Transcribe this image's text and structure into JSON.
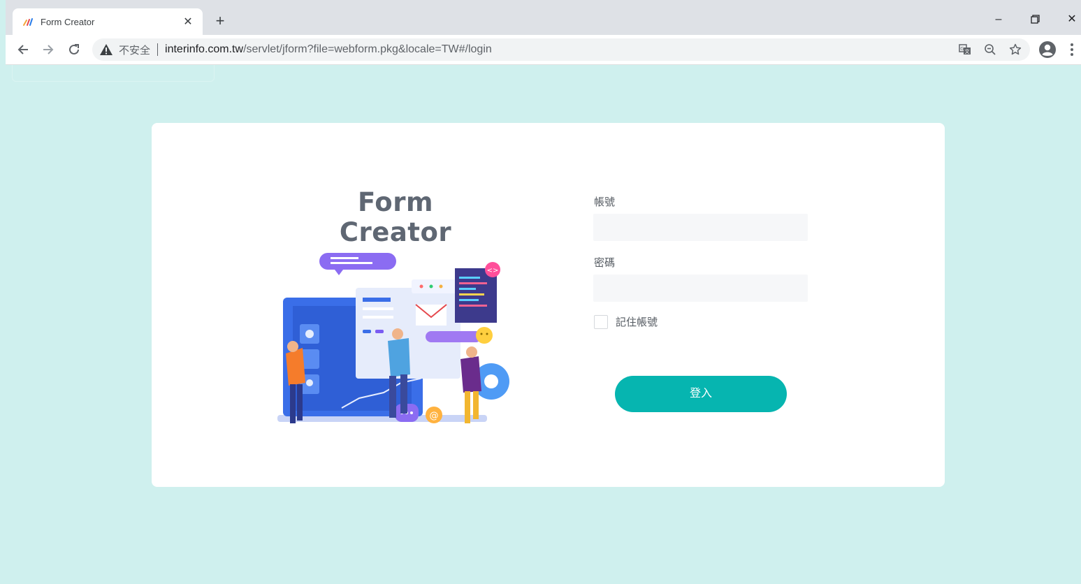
{
  "browser": {
    "tab": {
      "title": "Form Creator"
    },
    "address": {
      "security_label": "不安全",
      "host": "interinfo.com.tw",
      "path": "/servlet/jform?file=webform.pkg&locale=TW#/login"
    }
  },
  "login": {
    "brand": "Form Creator",
    "account_label": "帳號",
    "account_value": "",
    "password_label": "密碼",
    "password_value": "",
    "remember_label": "記住帳號",
    "remember_checked": false,
    "submit_label": "登入"
  },
  "colors": {
    "page_background": "#cff0ee",
    "card": "#ffffff",
    "accent": "#06b5b0",
    "brand_text": "#5f6773",
    "input_background": "#f6f7f9"
  },
  "icons": [
    "app-favicon",
    "close-icon",
    "plus-icon",
    "minimize-icon",
    "restore-icon",
    "back-icon",
    "forward-icon",
    "reload-icon",
    "warning-icon",
    "translate-icon",
    "zoom-out-icon",
    "star-icon",
    "profile-icon",
    "more-vert-icon"
  ]
}
